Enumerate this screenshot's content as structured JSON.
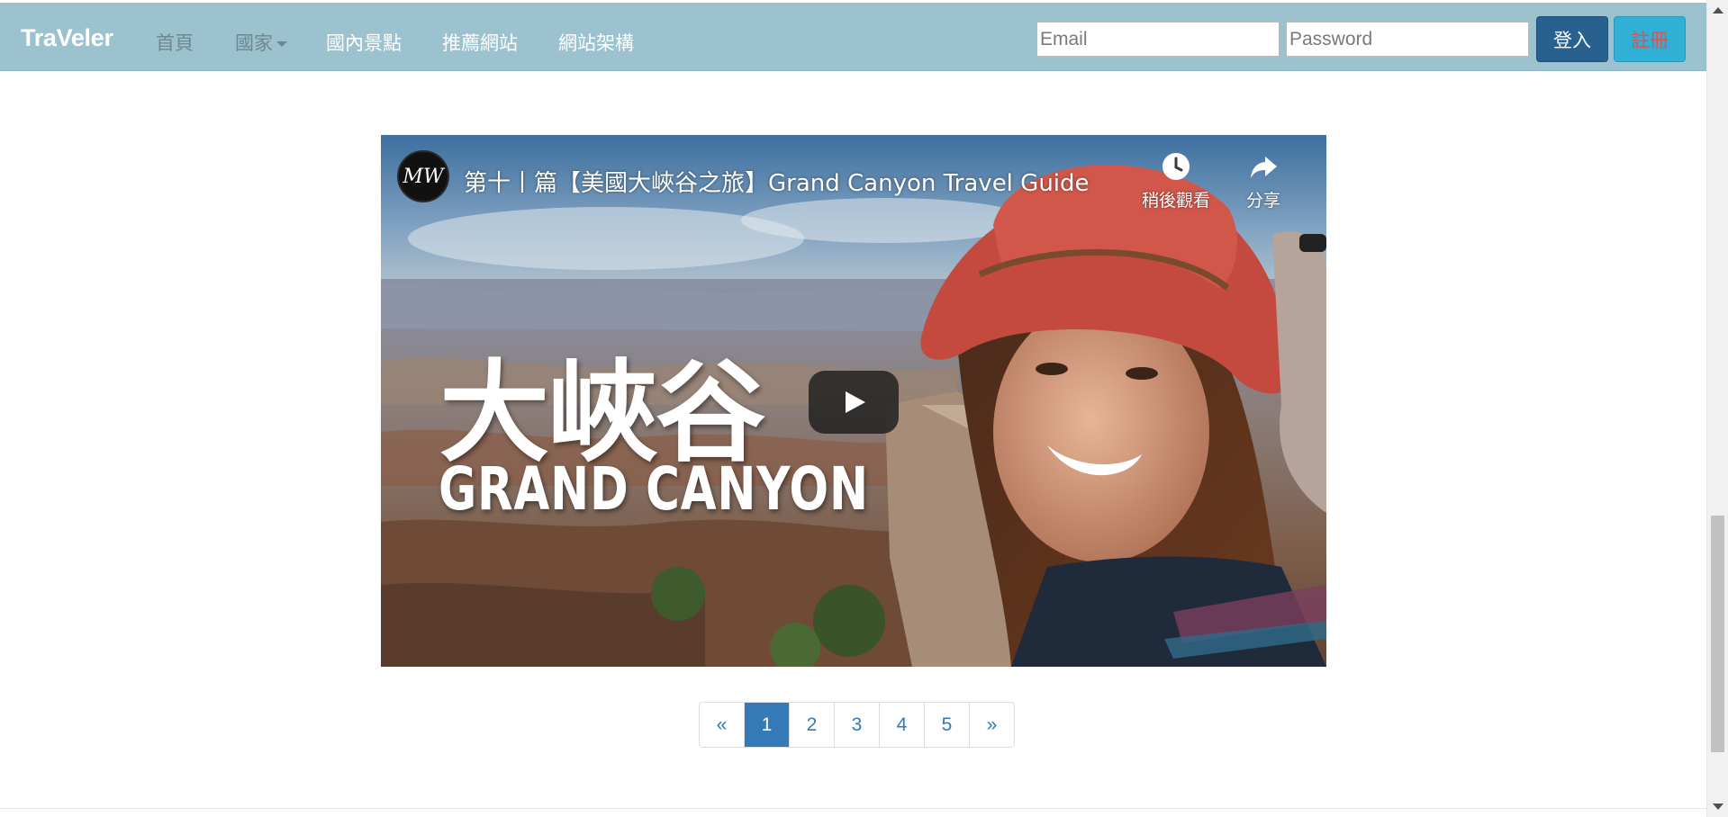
{
  "navbar": {
    "brand": "TraVeler",
    "links": [
      {
        "label": "首頁",
        "muted": true
      },
      {
        "label": "國家",
        "muted": true,
        "dropdown": true
      },
      {
        "label": "國內景點",
        "muted": false
      },
      {
        "label": "推薦網站",
        "muted": false
      },
      {
        "label": "網站架構",
        "muted": false
      }
    ],
    "email_placeholder": "Email",
    "password_placeholder": "Password",
    "login_label": "登入",
    "register_label": "註冊"
  },
  "video": {
    "channel_avatar_text": "MW",
    "title": "第十丨篇【美國大峽谷之旅】Grand Canyon Travel Guide",
    "watch_later_label": "稍後觀看",
    "share_label": "分享",
    "overlay_title_cn": "大峽谷",
    "overlay_title_en": "GRAND CANYON",
    "icons": [
      "clock-icon",
      "share-icon",
      "play-icon"
    ]
  },
  "pagination": {
    "prev": "«",
    "pages": [
      "1",
      "2",
      "3",
      "4",
      "5"
    ],
    "active_page": "1",
    "next": "»"
  },
  "colors": {
    "navbar_bg": "#9cc2cf",
    "login_bg": "#286090",
    "register_bg": "#31b0d5",
    "register_text": "#d9534f",
    "pagination_active": "#337ab7"
  }
}
